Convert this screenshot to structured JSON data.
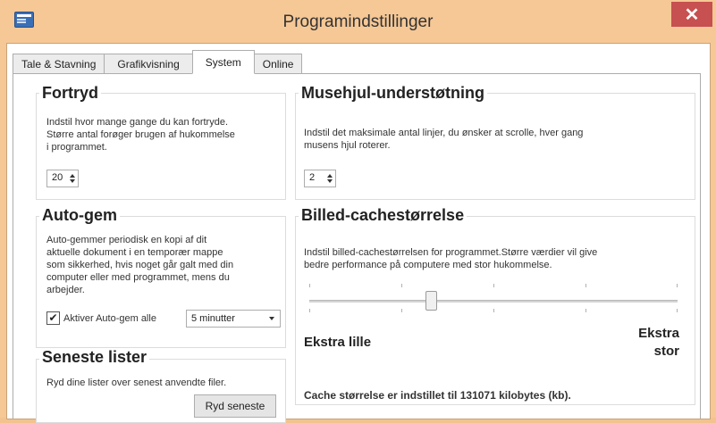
{
  "window": {
    "title": "Programindstillinger",
    "close_symbol": "✕"
  },
  "tabs": [
    {
      "label": "Tale & Stavning",
      "active": false
    },
    {
      "label": "Grafikvisning",
      "active": false
    },
    {
      "label": "System",
      "active": true
    },
    {
      "label": "Online",
      "active": false
    }
  ],
  "fortryd": {
    "title": "Fortryd",
    "desc_lines": [
      "Indstil hvor mange gange du kan fortryde.",
      "Større antal forøger brugen af hukommelse",
      "i programmet."
    ],
    "value": "20"
  },
  "musehjul": {
    "title": "Musehjul-understøtning",
    "desc_lines": [
      "Indstil det maksimale antal linjer, du ønsker at scrolle, hver gang",
      "musens hjul roterer."
    ],
    "value": "2"
  },
  "autogem": {
    "title": "Auto-gem",
    "desc_lines": [
      "Auto-gemmer periodisk en kopi af dit",
      "aktuelle dokument i en temporær mappe",
      "som sikkerhed, hvis noget går galt med din",
      "computer eller med programmet, mens du",
      "arbejder."
    ],
    "checkbox_label": "Aktiver Auto-gem alle",
    "checked": true,
    "check_symbol": "✔",
    "interval": "5 minutter"
  },
  "cache": {
    "title": "Billed-cachestørrelse",
    "desc_lines": [
      "Indstil billed-cachestørrelsen for programmet.Større værdier vil give",
      "bedre performance på computere med stor hukommelse."
    ],
    "min_label": "Ekstra lille",
    "max_label_lines": [
      "Ekstra",
      "stor"
    ],
    "status": "Cache størrelse er indstillet til 131071 kilobytes (kb)."
  },
  "recent": {
    "title": "Seneste lister",
    "desc": "Ryd dine lister over senest anvendte filer.",
    "button": "Ryd seneste"
  }
}
